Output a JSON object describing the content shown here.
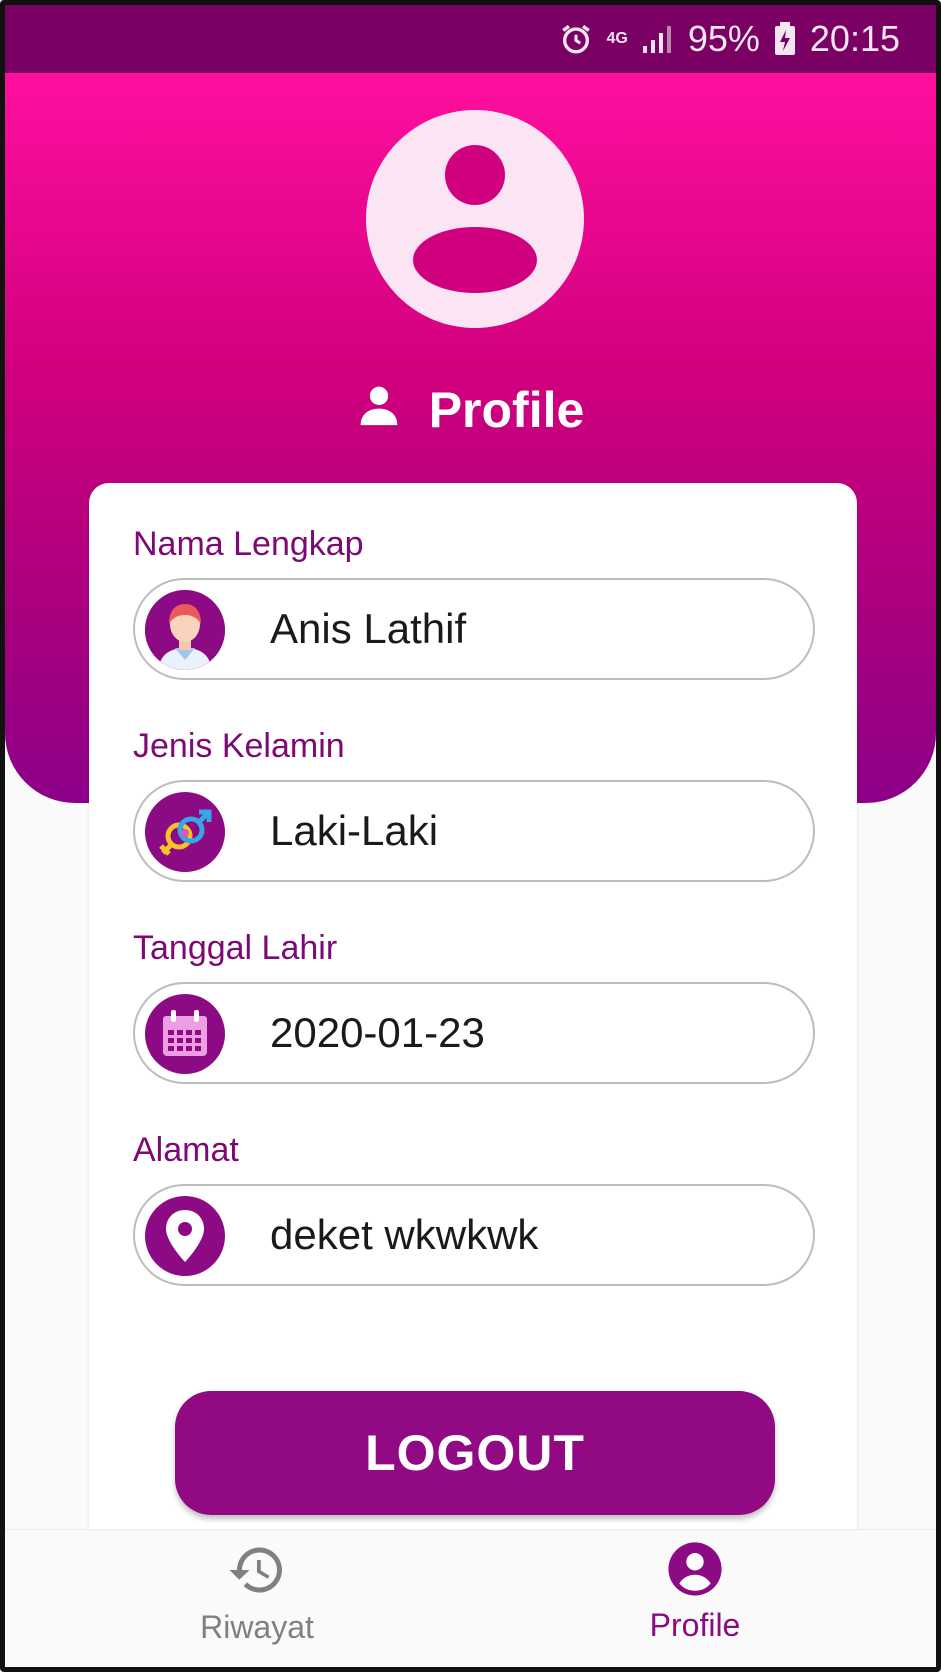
{
  "status_bar": {
    "network": "4G",
    "battery": "95%",
    "time": "20:15"
  },
  "header": {
    "title": "Profile"
  },
  "fields": [
    {
      "label": "Nama Lengkap",
      "value": "Anis Lathif",
      "icon": "user-avatar-icon"
    },
    {
      "label": "Jenis Kelamin",
      "value": "Laki-Laki",
      "icon": "gender-icon"
    },
    {
      "label": "Tanggal Lahir",
      "value": "2020-01-23",
      "icon": "calendar-icon"
    },
    {
      "label": "Alamat",
      "value": "deket wkwkwk",
      "icon": "location-pin-icon"
    }
  ],
  "logout_button": {
    "label": "LOGOUT"
  },
  "bottom_nav": {
    "items": [
      {
        "label": "Riwayat",
        "icon": "history-icon",
        "active": false
      },
      {
        "label": "Profile",
        "icon": "account-circle-icon",
        "active": true
      }
    ]
  },
  "colors": {
    "status_bar": "#7a0064",
    "header_gradient_top": "#ff0f9f",
    "header_gradient_bottom": "#8c0088",
    "accent": "#8d0a85",
    "label_text": "#7d0a74"
  }
}
